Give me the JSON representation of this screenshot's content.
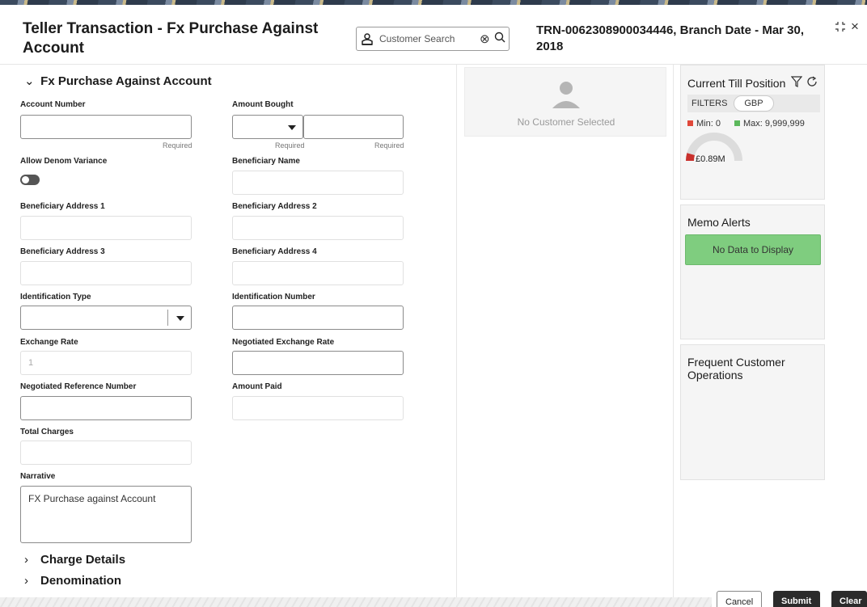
{
  "header": {
    "title": "Teller Transaction - Fx Purchase Against Account",
    "search_placeholder": "Customer Search",
    "transaction_info": "TRN-0062308900034446, Branch Date - Mar 30, 2018"
  },
  "form": {
    "section_title": "Fx Purchase Against Account",
    "account_number": {
      "label": "Account Number",
      "value": "",
      "hint": "Required"
    },
    "amount_bought": {
      "label": "Amount Bought",
      "currency": "",
      "value": "",
      "currency_hint": "Required",
      "value_hint": "Required"
    },
    "allow_denom_variance": {
      "label": "Allow Denom Variance",
      "on": false
    },
    "beneficiary_name": {
      "label": "Beneficiary Name",
      "value": ""
    },
    "beneficiary_address_1": {
      "label": "Beneficiary Address 1",
      "value": ""
    },
    "beneficiary_address_2": {
      "label": "Beneficiary Address 2",
      "value": ""
    },
    "beneficiary_address_3": {
      "label": "Beneficiary Address 3",
      "value": ""
    },
    "beneficiary_address_4": {
      "label": "Beneficiary Address 4",
      "value": ""
    },
    "identification_type": {
      "label": "Identification Type",
      "value": ""
    },
    "identification_number": {
      "label": "Identification Number",
      "value": ""
    },
    "exchange_rate": {
      "label": "Exchange Rate",
      "value": "1"
    },
    "negotiated_exchange_rate": {
      "label": "Negotiated Exchange Rate",
      "value": ""
    },
    "negotiated_reference_number": {
      "label": "Negotiated Reference Number",
      "value": ""
    },
    "amount_paid": {
      "label": "Amount Paid",
      "value": ""
    },
    "total_charges": {
      "label": "Total Charges",
      "value": ""
    },
    "narrative": {
      "label": "Narrative",
      "value": "FX Purchase against Account"
    },
    "charge_details_label": "Charge Details",
    "denomination_label": "Denomination"
  },
  "customer": {
    "empty_text": "No Customer Selected"
  },
  "till_position": {
    "title": "Current Till Position",
    "filters_label": "FILTERS",
    "currency": "GBP",
    "min_label": "Min: 0",
    "max_label": "Max: 9,999,999",
    "gauge_value": "£0.89M",
    "gauge_fraction": 0.09,
    "min_color": "#e0483a",
    "max_color": "#5cb85c"
  },
  "memo_alerts": {
    "title": "Memo Alerts",
    "empty_text": "No Data to Display"
  },
  "frequent_ops": {
    "title": "Frequent Customer Operations"
  },
  "actions": {
    "cancel": "Cancel",
    "submit": "Submit",
    "clear": "Clear"
  }
}
